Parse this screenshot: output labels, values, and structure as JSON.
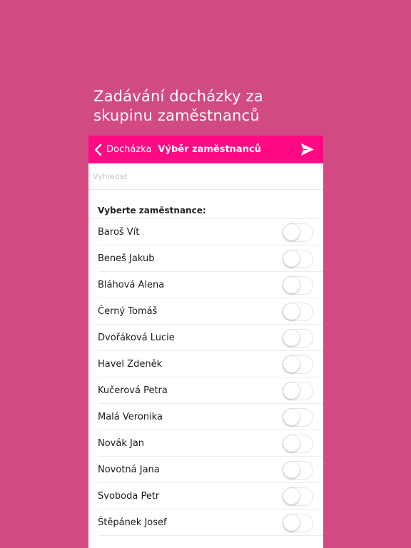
{
  "headline": {
    "line1": "Zadávání docházky za",
    "line2": "skupinu zaměstnanců"
  },
  "navbar": {
    "back_label": "Docházka",
    "title": "Výběr zaměstnanců",
    "send_icon": "send-icon"
  },
  "search": {
    "placeholder": "Vyhledat"
  },
  "section": {
    "title": "Vyberte zaměstnance:"
  },
  "employees": [
    {
      "name": "Baroš Vít",
      "selected": false
    },
    {
      "name": "Beneš Jakub",
      "selected": false
    },
    {
      "name": "Bláhová Alena",
      "selected": false
    },
    {
      "name": "Černý Tomáš",
      "selected": false
    },
    {
      "name": "Dvořáková Lucie",
      "selected": false
    },
    {
      "name": "Havel Zdeněk",
      "selected": false
    },
    {
      "name": "Kučerová Petra",
      "selected": false
    },
    {
      "name": "Malá Veronika",
      "selected": false
    },
    {
      "name": "Novák Jan",
      "selected": false
    },
    {
      "name": "Novotná Jana",
      "selected": false
    },
    {
      "name": "Svoboda Petr",
      "selected": false
    },
    {
      "name": "Štěpánek Josef",
      "selected": false
    }
  ],
  "colors": {
    "background": "#d14b82",
    "accent": "#ff0a85"
  }
}
